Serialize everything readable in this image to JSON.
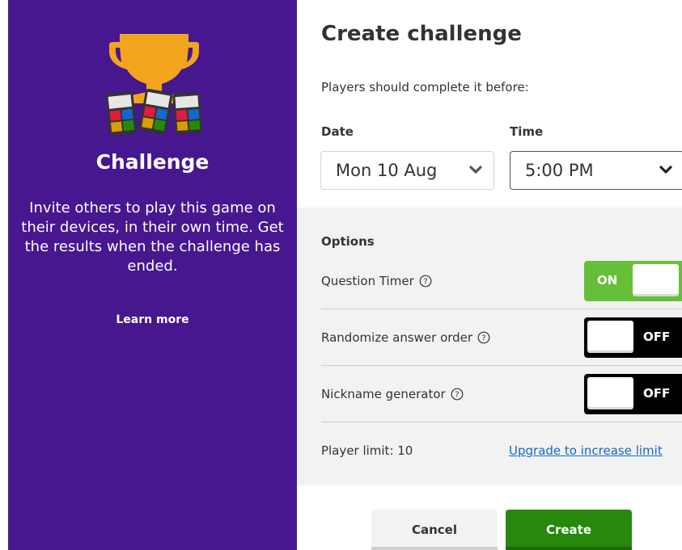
{
  "sidebar": {
    "title": "Challenge",
    "description": "Invite others to play this game on their devices, in their own time. Get the results when the challenge has ended.",
    "learn_more": "Learn more"
  },
  "main": {
    "title": "Create challenge",
    "subtitle": "Players should complete it before:",
    "date_label": "Date",
    "date_value": "Mon 10 Aug",
    "time_label": "Time",
    "time_value": "5:00 PM"
  },
  "options": {
    "title": "Options",
    "items": [
      {
        "label": "Question Timer",
        "state": "ON"
      },
      {
        "label": "Randomize answer order",
        "state": "OFF"
      },
      {
        "label": "Nickname generator",
        "state": "OFF"
      }
    ],
    "player_limit": "Player limit: 10",
    "upgrade_link": "Upgrade to increase limit"
  },
  "buttons": {
    "cancel": "Cancel",
    "create": "Create"
  },
  "colors": {
    "sidebar_bg": "#46178f",
    "toggle_on": "#66bf39",
    "toggle_off": "#000000",
    "create_button": "#26890c",
    "link": "#1368ce"
  },
  "icons": {
    "hero": "trophy-with-phones-icon",
    "help": "question-circle-icon",
    "dropdown": "chevron-down-icon"
  }
}
